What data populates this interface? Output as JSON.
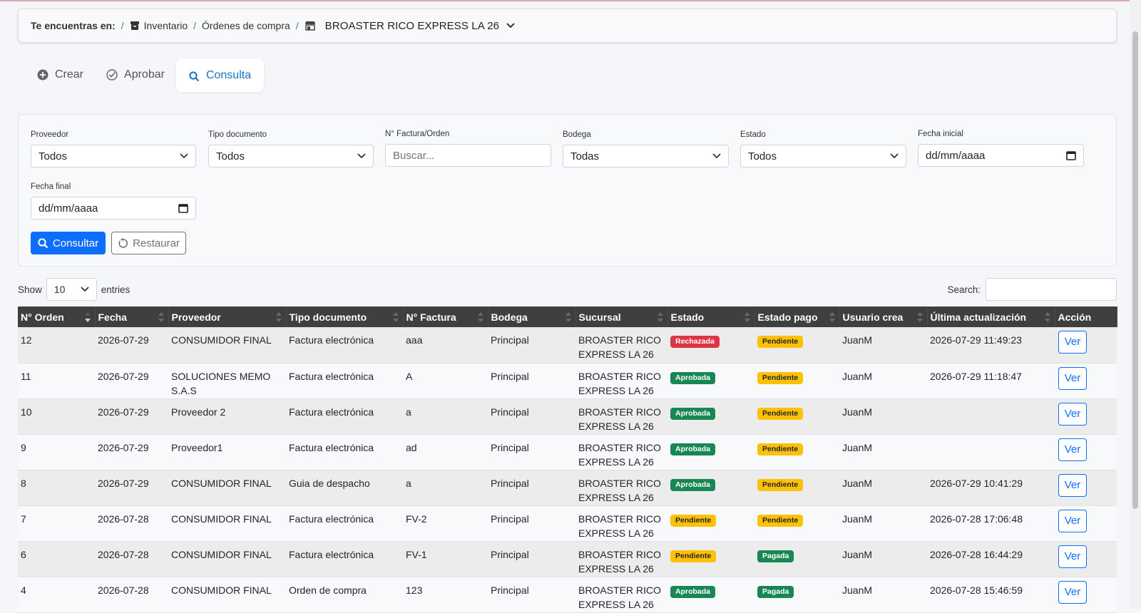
{
  "breadcrumb": {
    "lead": "Te encuentras en:",
    "items": [
      "Inventario",
      "Órdenes de compra",
      "BROASTER RICO EXPRESS LA 26"
    ]
  },
  "tabs": [
    {
      "label": "Crear",
      "icon": "plus-circle-icon",
      "active": false
    },
    {
      "label": "Aprobar",
      "icon": "check-circle-icon",
      "active": false
    },
    {
      "label": "Consulta",
      "icon": "search-icon",
      "active": true
    }
  ],
  "filters": {
    "proveedor": {
      "label": "Proveedor",
      "value": "Todos"
    },
    "tipo_documento": {
      "label": "Tipo documento",
      "value": "Todos"
    },
    "factura": {
      "label": "N° Factura/Orden",
      "placeholder": "Buscar..."
    },
    "bodega": {
      "label": "Bodega",
      "value": "Todas"
    },
    "estado": {
      "label": "Estado",
      "value": "Todos"
    },
    "fecha_inicial": {
      "label": "Fecha inicial",
      "value": "dd/mm/aaaa"
    },
    "fecha_final": {
      "label": "Fecha final",
      "value": "dd/mm/aaaa"
    },
    "consultar": "Consultar",
    "restaurar": "Restaurar"
  },
  "table_controls": {
    "show": "Show",
    "entries_value": "10",
    "entries": "entries",
    "search": "Search:"
  },
  "columns": [
    "N° Orden",
    "Fecha",
    "Proveedor",
    "Tipo documento",
    "N° Factura",
    "Bodega",
    "Sucursal",
    "Estado",
    "Estado pago",
    "Usuario crea",
    "Última actualización",
    "Acción"
  ],
  "rows": [
    {
      "orden": "12",
      "fecha": "2026-07-29",
      "proveedor": "CONSUMIDOR FINAL",
      "tipo": "Factura electrónica",
      "factura": "aaa",
      "bodega": "Principal",
      "sucursal": "BROASTER RICO EXPRESS LA 26",
      "estado": "Rechazada",
      "estado_pago": "Pendiente",
      "usuario": "JuanM",
      "actualizacion": "2026-07-29 11:49:23",
      "accion": "Ver"
    },
    {
      "orden": "11",
      "fecha": "2026-07-29",
      "proveedor": "SOLUCIONES MEMO S.A.S",
      "tipo": "Factura electrónica",
      "factura": "A",
      "bodega": "Principal",
      "sucursal": "BROASTER RICO EXPRESS LA 26",
      "estado": "Aprobada",
      "estado_pago": "Pendiente",
      "usuario": "JuanM",
      "actualizacion": "2026-07-29 11:18:47",
      "accion": "Ver"
    },
    {
      "orden": "10",
      "fecha": "2026-07-29",
      "proveedor": "Proveedor 2",
      "tipo": "Factura electrónica",
      "factura": "a",
      "bodega": "Principal",
      "sucursal": "BROASTER RICO EXPRESS LA 26",
      "estado": "Aprobada",
      "estado_pago": "Pendiente",
      "usuario": "JuanM",
      "actualizacion": "",
      "accion": "Ver"
    },
    {
      "orden": "9",
      "fecha": "2026-07-29",
      "proveedor": "Proveedor1",
      "tipo": "Factura electrónica",
      "factura": "ad",
      "bodega": "Principal",
      "sucursal": "BROASTER RICO EXPRESS LA 26",
      "estado": "Aprobada",
      "estado_pago": "Pendiente",
      "usuario": "JuanM",
      "actualizacion": "",
      "accion": "Ver"
    },
    {
      "orden": "8",
      "fecha": "2026-07-29",
      "proveedor": "CONSUMIDOR FINAL",
      "tipo": "Guia de despacho",
      "factura": "a",
      "bodega": "Principal",
      "sucursal": "BROASTER RICO EXPRESS LA 26",
      "estado": "Aprobada",
      "estado_pago": "Pendiente",
      "usuario": "JuanM",
      "actualizacion": "2026-07-29 10:41:29",
      "accion": "Ver"
    },
    {
      "orden": "7",
      "fecha": "2026-07-28",
      "proveedor": "CONSUMIDOR FINAL",
      "tipo": "Factura electrónica",
      "factura": "FV-2",
      "bodega": "Principal",
      "sucursal": "BROASTER RICO EXPRESS LA 26",
      "estado": "Pendiente",
      "estado_pago": "Pendiente",
      "usuario": "JuanM",
      "actualizacion": "2026-07-28 17:06:48",
      "accion": "Ver"
    },
    {
      "orden": "6",
      "fecha": "2026-07-28",
      "proveedor": "CONSUMIDOR FINAL",
      "tipo": "Factura electrónica",
      "factura": "FV-1",
      "bodega": "Principal",
      "sucursal": "BROASTER RICO EXPRESS LA 26",
      "estado": "Pendiente",
      "estado_pago": "Pagada",
      "usuario": "JuanM",
      "actualizacion": "2026-07-28 16:44:29",
      "accion": "Ver"
    },
    {
      "orden": "4",
      "fecha": "2026-07-28",
      "proveedor": "CONSUMIDOR FINAL",
      "tipo": "Orden de compra",
      "factura": "123",
      "bodega": "Principal",
      "sucursal": "BROASTER RICO EXPRESS LA 26",
      "estado": "Aprobada",
      "estado_pago": "Pagada",
      "usuario": "JuanM",
      "actualizacion": "2026-07-28 15:46:59",
      "accion": "Ver"
    }
  ],
  "status_colors": {
    "Rechazada": "#dc3545",
    "Aprobada": "#198754",
    "Pendiente": "#ffc107",
    "Pagada": "#198754"
  }
}
